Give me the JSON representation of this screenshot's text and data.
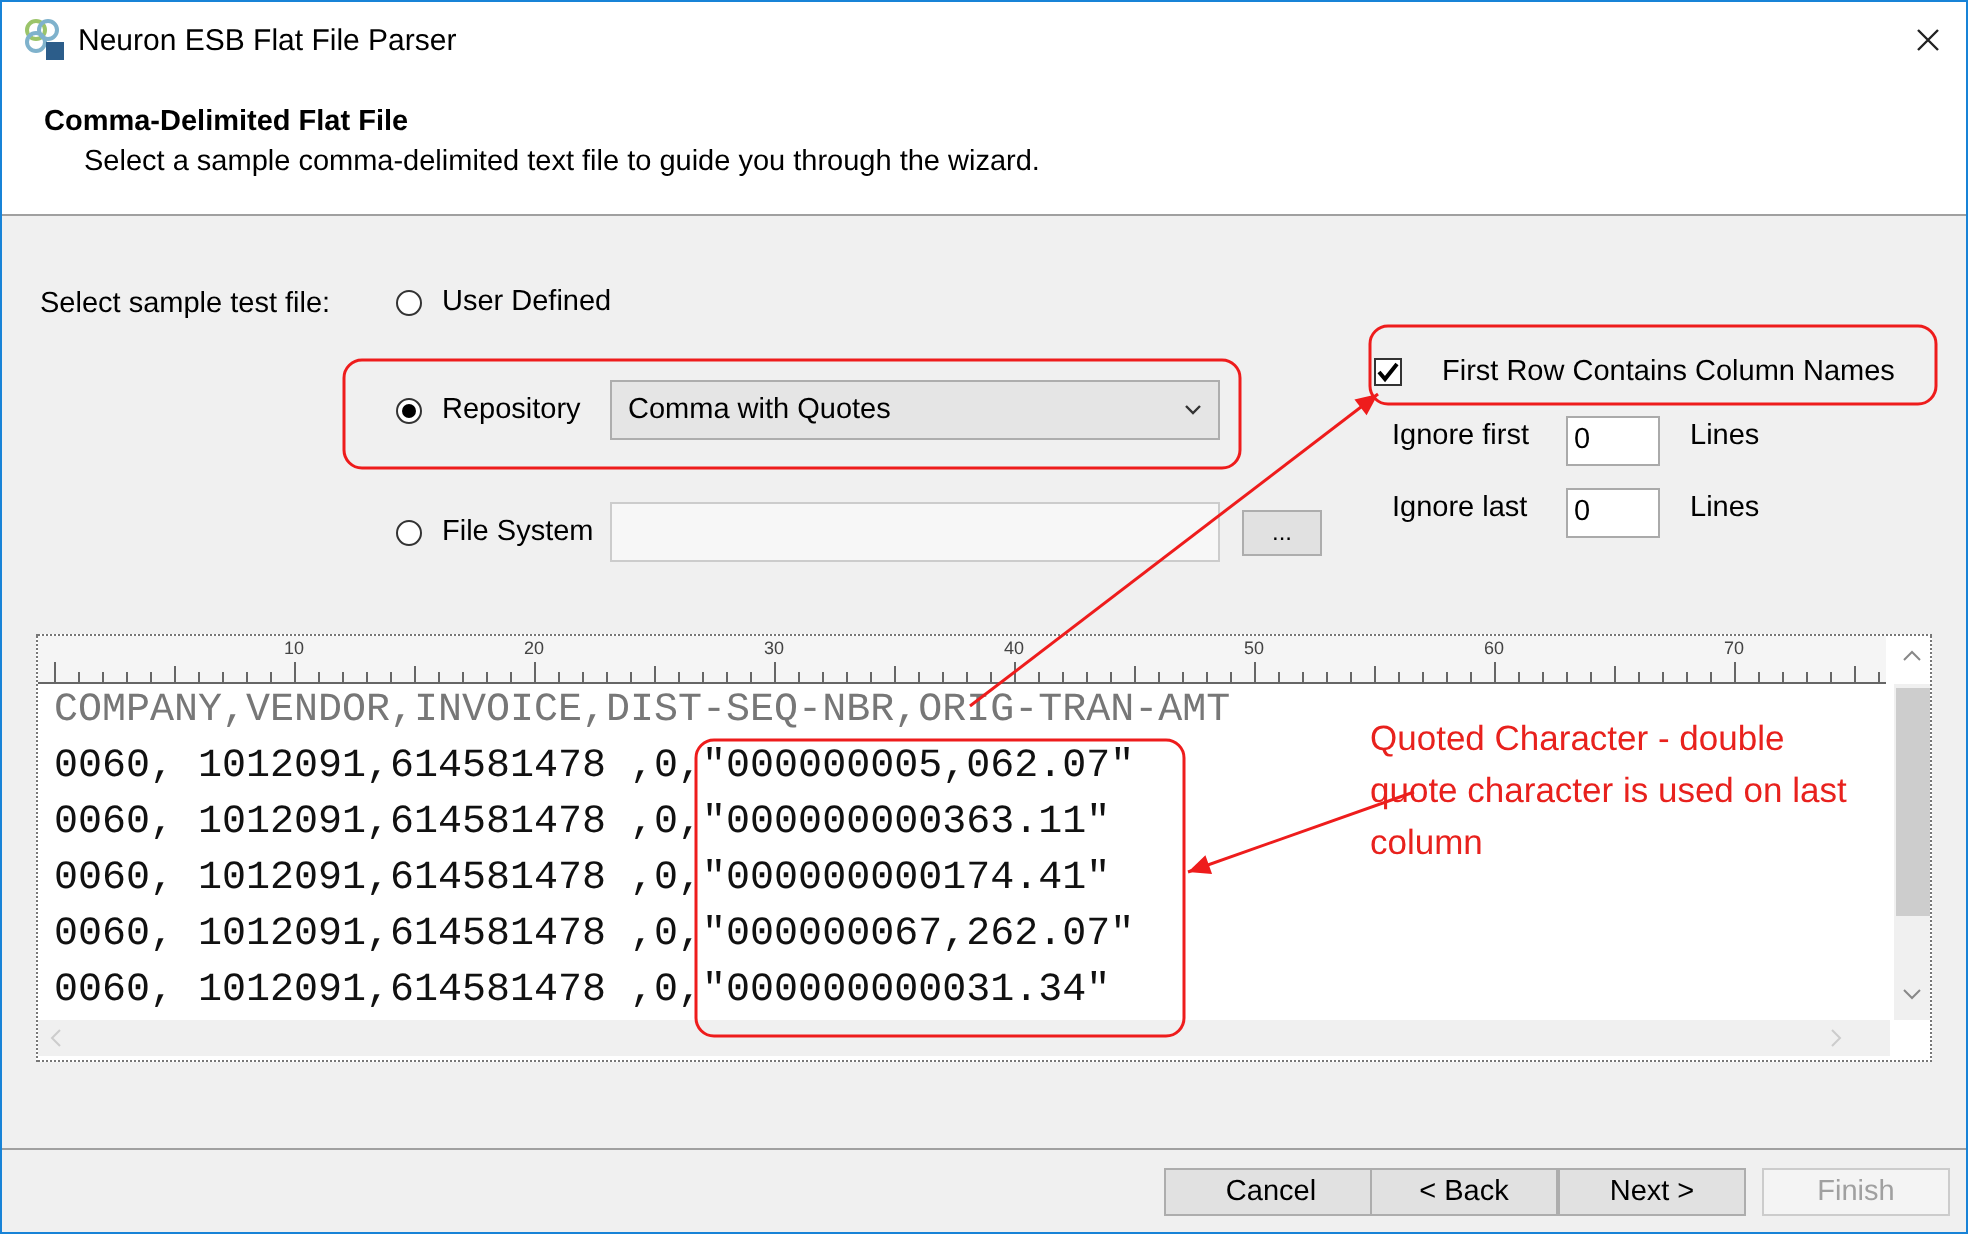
{
  "window": {
    "title": "Neuron ESB Flat File Parser"
  },
  "header": {
    "title": "Comma-Delimited Flat File",
    "subtitle": "Select a sample comma-delimited text file to guide you through the wizard."
  },
  "source": {
    "label": "Select sample test file:",
    "options": [
      {
        "kind": "plain",
        "label": "User Defined",
        "selected": false
      },
      {
        "kind": "dropdown",
        "label": "Repository",
        "selected": true,
        "value": "Comma with Quotes"
      },
      {
        "kind": "file",
        "label": "File System",
        "selected": false,
        "browse": "..."
      }
    ]
  },
  "settings": {
    "first_row": {
      "label": "First Row Contains Column Names",
      "checked": true
    },
    "ignore": [
      {
        "label": "Ignore first",
        "value": "0",
        "unit": "Lines"
      },
      {
        "label": "Ignore last",
        "value": "0",
        "unit": "Lines"
      }
    ]
  },
  "preview": {
    "ruler": [
      "10",
      "20",
      "30",
      "40",
      "50",
      "60",
      "70"
    ],
    "lines": [
      {
        "kind": "header",
        "text": "COMPANY,VENDOR,INVOICE,DIST-SEQ-NBR,ORIG-TRAN-AMT"
      },
      {
        "kind": "data",
        "text": "0060, 1012091,614581478 ,0,\"000000005,062.07\""
      },
      {
        "kind": "data",
        "text": "0060, 1012091,614581478 ,0,\"000000000363.11\""
      },
      {
        "kind": "data",
        "text": "0060, 1012091,614581478 ,0,\"000000000174.41\""
      },
      {
        "kind": "data",
        "text": "0060, 1012091,614581478 ,0,\"000000067,262.07\""
      },
      {
        "kind": "data",
        "text": "0060, 1012091,614581478 ,0,\"000000000031.34\""
      }
    ]
  },
  "annotation": {
    "text": "Quoted Character - double quote character is used on last column"
  },
  "buttons": [
    {
      "label": "Cancel",
      "disabled": false
    },
    {
      "label": "< Back",
      "disabled": false
    },
    {
      "label": "Next >",
      "disabled": false
    },
    {
      "label": "Finish",
      "disabled": true
    }
  ]
}
